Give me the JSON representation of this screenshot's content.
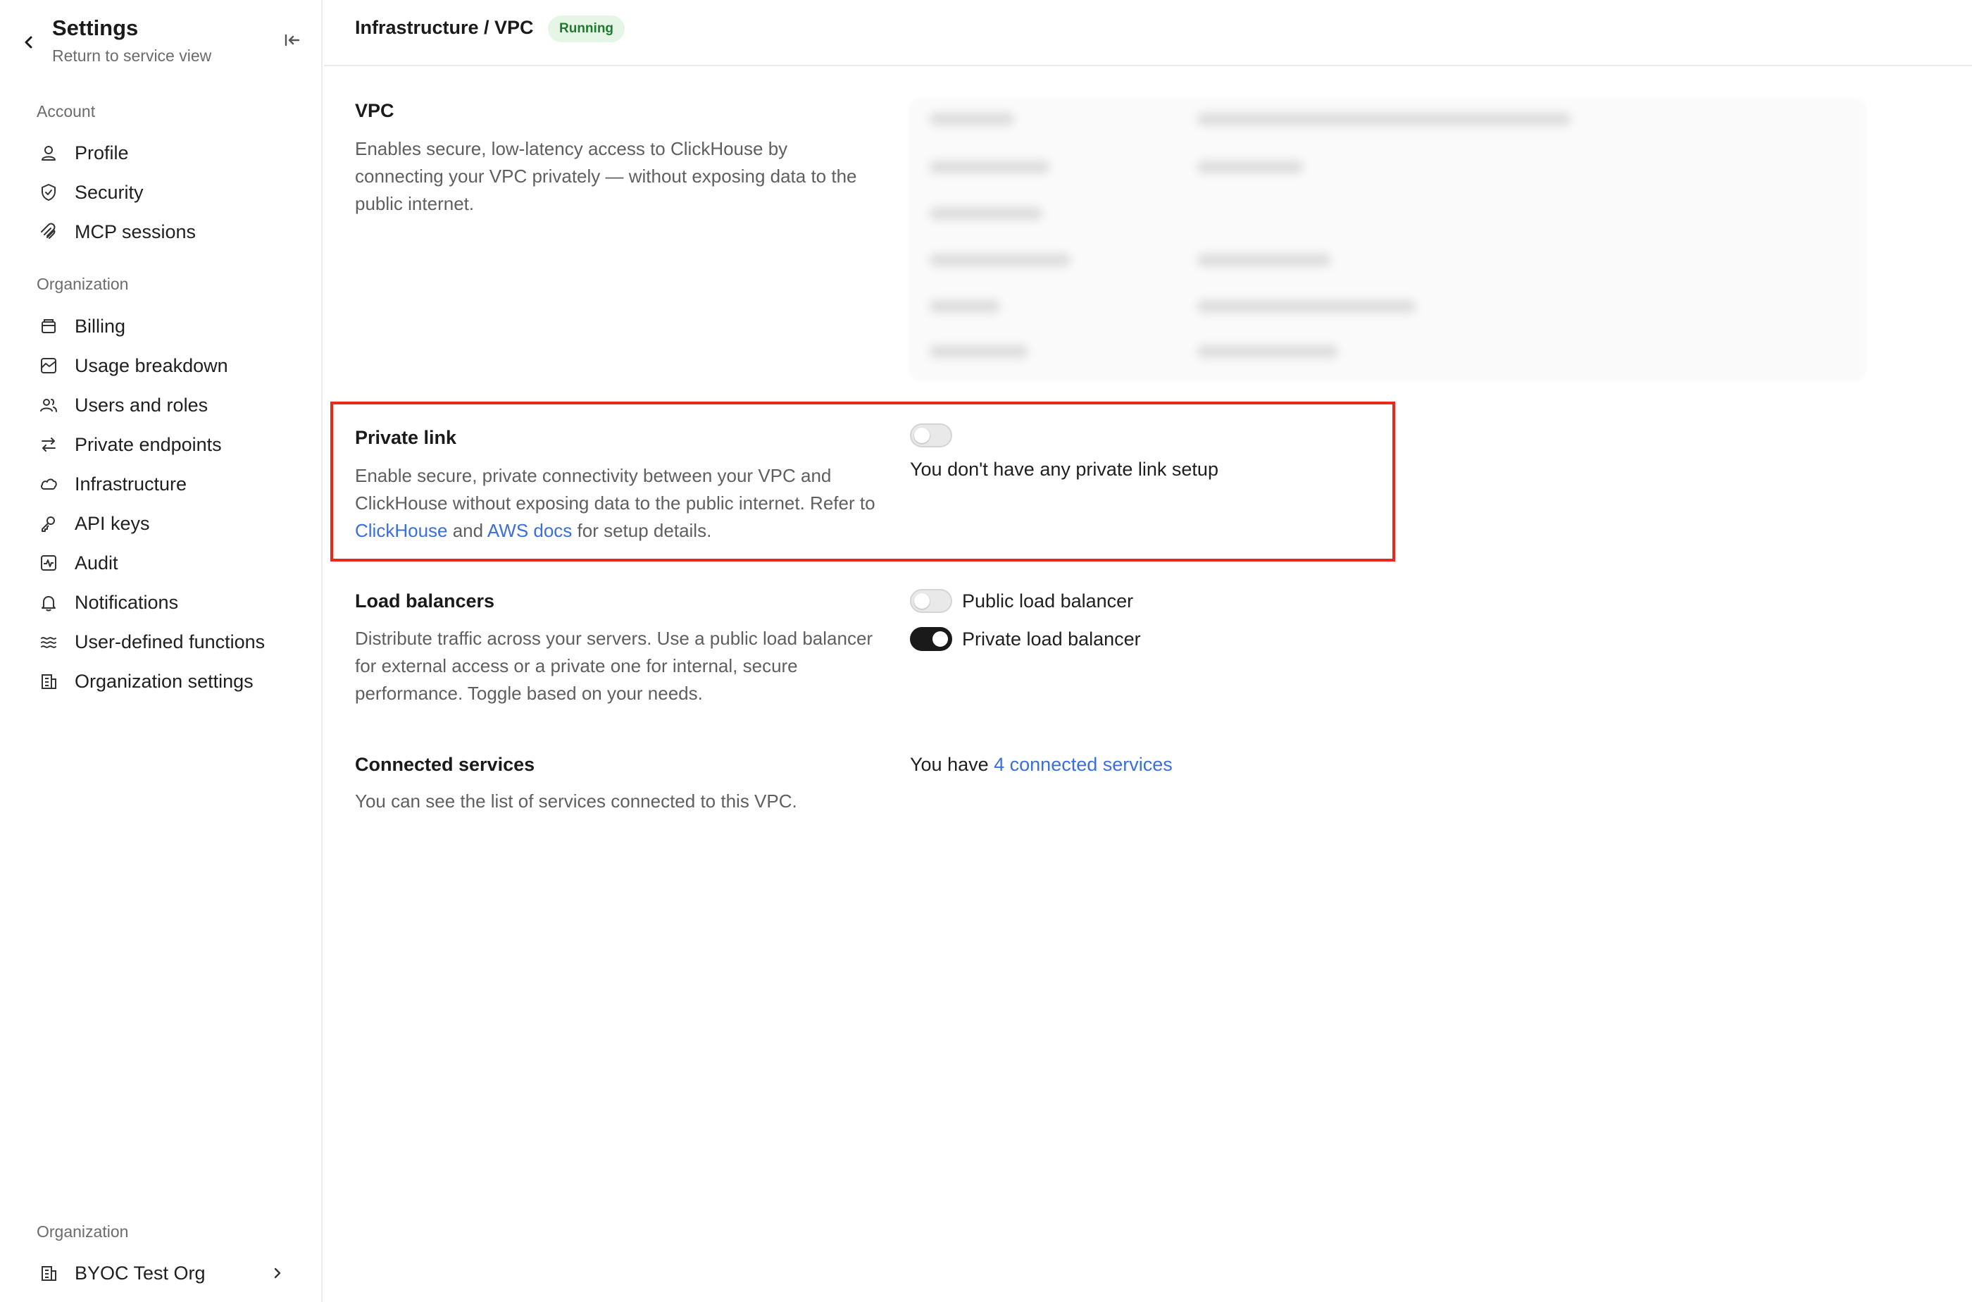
{
  "sidebar": {
    "title": "Settings",
    "subtitle": "Return to service view",
    "account_label": "Account",
    "account_items": [
      {
        "label": "Profile",
        "icon": "user-icon"
      },
      {
        "label": "Security",
        "icon": "shield-icon"
      },
      {
        "label": "MCP sessions",
        "icon": "mcp-icon"
      }
    ],
    "organization_label": "Organization",
    "organization_items": [
      {
        "label": "Billing",
        "icon": "billing-icon"
      },
      {
        "label": "Usage breakdown",
        "icon": "chart-icon"
      },
      {
        "label": "Users and roles",
        "icon": "users-icon"
      },
      {
        "label": "Private endpoints",
        "icon": "arrows-icon"
      },
      {
        "label": "Infrastructure",
        "icon": "cloud-icon"
      },
      {
        "label": "API keys",
        "icon": "key-icon"
      },
      {
        "label": "Audit",
        "icon": "audit-icon"
      },
      {
        "label": "Notifications",
        "icon": "bell-icon"
      },
      {
        "label": "User-defined functions",
        "icon": "functions-icon"
      },
      {
        "label": "Organization settings",
        "icon": "building-icon"
      }
    ],
    "footer_label": "Organization",
    "org_name": "BYOC Test Org"
  },
  "header": {
    "breadcrumb": "Infrastructure / VPC",
    "status": "Running"
  },
  "sections": {
    "vpc": {
      "title": "VPC",
      "description": "Enables secure, low-latency access to ClickHouse by connecting your VPC privately — without exposing data to the public internet."
    },
    "private_link": {
      "title": "Private link",
      "desc_part1": "Enable secure, private connectivity between your VPC and ClickHouse without exposing data to the public internet. Refer to ",
      "link1": "ClickHouse",
      "desc_part2": " and ",
      "link2": "AWS docs",
      "desc_part3": " for setup details.",
      "toggle_state": "off",
      "status_text": "You don't have any private link setup"
    },
    "load_balancers": {
      "title": "Load balancers",
      "description": "Distribute traffic across your servers. Use a public load balancer for external access or a private one for internal, secure performance. Toggle based on your needs.",
      "public_label": "Public load balancer",
      "public_state": "off",
      "private_label": "Private load balancer",
      "private_state": "on"
    },
    "connected_services": {
      "title": "Connected services",
      "description": "You can see the list of services connected to this VPC.",
      "prefix": "You have ",
      "link": "4 connected services"
    }
  },
  "colors": {
    "accent_link": "#3b6fd9",
    "highlight_border": "#e8291c",
    "status_bg": "#e6f6e6",
    "status_text": "#1f7a2e"
  }
}
